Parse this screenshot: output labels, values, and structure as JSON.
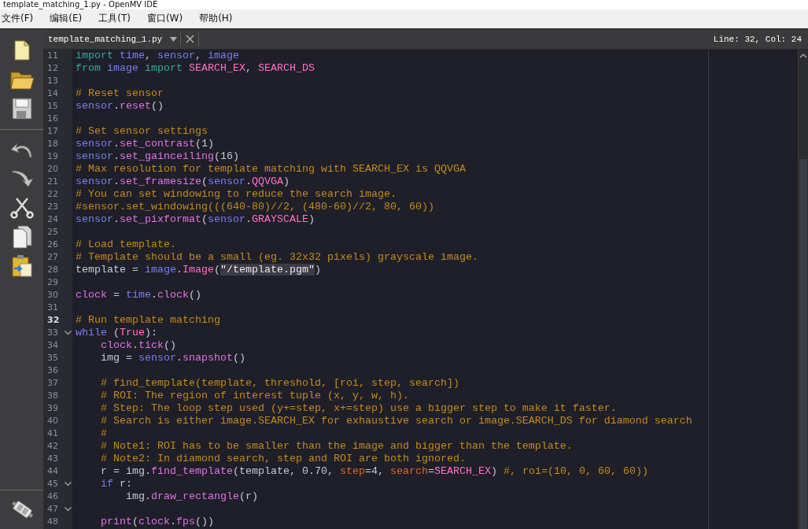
{
  "window": {
    "title": "template_matching_1.py - OpenMV IDE"
  },
  "menu": [
    {
      "label": "文件(F)"
    },
    {
      "label": "编辑(E)"
    },
    {
      "label": "工具(T)"
    },
    {
      "label": "窗口(W)"
    },
    {
      "label": "帮助(H)"
    }
  ],
  "tab": {
    "label": "template_matching_1.py",
    "selected": true
  },
  "cursor_position": "Line: 32, Col: 24",
  "editor": {
    "lines": [
      {
        "number": "11",
        "fold": false,
        "current": false,
        "tokens": [
          {
            "kind": "keyword",
            "text": "import"
          },
          {
            "kind": "name",
            "text": " time"
          },
          {
            "kind": "plain",
            "text": ", "
          },
          {
            "kind": "name",
            "text": "sensor"
          },
          {
            "kind": "plain",
            "text": ", "
          },
          {
            "kind": "name",
            "text": "image"
          }
        ]
      },
      {
        "number": "12",
        "fold": false,
        "current": false,
        "tokens": [
          {
            "kind": "keyword",
            "text": "from"
          },
          {
            "kind": "name",
            "text": " image"
          },
          {
            "kind": "keyword",
            "text": " import"
          },
          {
            "kind": "constant",
            "text": " SEARCH_EX"
          },
          {
            "kind": "plain",
            "text": ", "
          },
          {
            "kind": "constant",
            "text": "SEARCH_DS"
          }
        ]
      },
      {
        "number": "13",
        "fold": false,
        "current": false
      },
      {
        "number": "14",
        "fold": false,
        "current": false,
        "tokens": [
          {
            "kind": "comment",
            "text": "# Reset sensor"
          }
        ]
      },
      {
        "number": "15",
        "fold": false,
        "current": false,
        "tokens": [
          {
            "kind": "name",
            "text": "sensor"
          },
          {
            "kind": "plain",
            "text": "."
          },
          {
            "kind": "call",
            "text": "reset"
          },
          {
            "kind": "plain",
            "text": "()"
          }
        ]
      },
      {
        "number": "16",
        "fold": false,
        "current": false
      },
      {
        "number": "17",
        "fold": false,
        "current": false,
        "tokens": [
          {
            "kind": "comment",
            "text": "# Set sensor settings"
          }
        ]
      },
      {
        "number": "18",
        "fold": false,
        "current": false,
        "tokens": [
          {
            "kind": "name",
            "text": "sensor"
          },
          {
            "kind": "plain",
            "text": "."
          },
          {
            "kind": "call",
            "text": "set_contrast"
          },
          {
            "kind": "plain",
            "text": "(1)"
          }
        ]
      },
      {
        "number": "19",
        "fold": false,
        "current": false,
        "tokens": [
          {
            "kind": "name",
            "text": "sensor"
          },
          {
            "kind": "plain",
            "text": "."
          },
          {
            "kind": "call",
            "text": "set_gainceiling"
          },
          {
            "kind": "plain",
            "text": "(16)"
          }
        ]
      },
      {
        "number": "20",
        "fold": false,
        "current": false,
        "tokens": [
          {
            "kind": "comment",
            "text": "# Max resolution for template matching with SEARCH_EX is QQVGA"
          }
        ]
      },
      {
        "number": "21",
        "fold": false,
        "current": false,
        "tokens": [
          {
            "kind": "name",
            "text": "sensor"
          },
          {
            "kind": "plain",
            "text": "."
          },
          {
            "kind": "call",
            "text": "set_framesize"
          },
          {
            "kind": "plain",
            "text": "("
          },
          {
            "kind": "name",
            "text": "sensor"
          },
          {
            "kind": "plain",
            "text": "."
          },
          {
            "kind": "constant",
            "text": "QQVGA"
          },
          {
            "kind": "plain",
            "text": ")"
          }
        ]
      },
      {
        "number": "22",
        "fold": false,
        "current": false,
        "tokens": [
          {
            "kind": "comment",
            "text": "# You can set windowing to reduce the search image."
          }
        ]
      },
      {
        "number": "23",
        "fold": false,
        "current": false,
        "tokens": [
          {
            "kind": "comment",
            "text": "#sensor.set_windowing(((640-80)//2, (480-60)//2, 80, 60))"
          }
        ]
      },
      {
        "number": "24",
        "fold": false,
        "current": false,
        "tokens": [
          {
            "kind": "name",
            "text": "sensor"
          },
          {
            "kind": "plain",
            "text": "."
          },
          {
            "kind": "call",
            "text": "set_pixformat"
          },
          {
            "kind": "plain",
            "text": "("
          },
          {
            "kind": "name",
            "text": "sensor"
          },
          {
            "kind": "plain",
            "text": "."
          },
          {
            "kind": "constant",
            "text": "GRAYSCALE"
          },
          {
            "kind": "plain",
            "text": ")"
          }
        ]
      },
      {
        "number": "25",
        "fold": false,
        "current": false
      },
      {
        "number": "26",
        "fold": false,
        "current": false,
        "tokens": [
          {
            "kind": "comment",
            "text": "# Load template."
          }
        ]
      },
      {
        "number": "27",
        "fold": false,
        "current": false,
        "tokens": [
          {
            "kind": "comment",
            "text": "# Template should be a small (eg. 32x32 pixels) grayscale image."
          }
        ]
      },
      {
        "number": "28",
        "fold": false,
        "current": false,
        "tokens": [
          {
            "kind": "plain",
            "text": "template = "
          },
          {
            "kind": "name",
            "text": "image"
          },
          {
            "kind": "plain",
            "text": "."
          },
          {
            "kind": "constant",
            "text": "Image"
          },
          {
            "kind": "plain",
            "text": "("
          },
          {
            "kind": "string",
            "text": "\"/template.pgm\""
          },
          {
            "kind": "plain",
            "text": ")"
          }
        ]
      },
      {
        "number": "29",
        "fold": false,
        "current": false
      },
      {
        "number": "30",
        "fold": false,
        "current": false,
        "tokens": [
          {
            "kind": "call",
            "text": "clock"
          },
          {
            "kind": "plain",
            "text": " = "
          },
          {
            "kind": "name",
            "text": "time"
          },
          {
            "kind": "plain",
            "text": "."
          },
          {
            "kind": "call",
            "text": "clock"
          },
          {
            "kind": "plain",
            "text": "()"
          }
        ]
      },
      {
        "number": "31",
        "fold": false,
        "current": false
      },
      {
        "number": "32",
        "fold": false,
        "current": true,
        "tokens": [
          {
            "kind": "comment",
            "text": "# Run template matching"
          }
        ]
      },
      {
        "number": "33",
        "fold": true,
        "current": false,
        "tokens": [
          {
            "kind": "name",
            "text": "while"
          },
          {
            "kind": "plain",
            "text": " ("
          },
          {
            "kind": "constant",
            "text": "True"
          },
          {
            "kind": "plain",
            "text": "):"
          }
        ]
      },
      {
        "number": "34",
        "fold": false,
        "current": false,
        "tokens": [
          {
            "kind": "call",
            "text": "    clock"
          },
          {
            "kind": "plain",
            "text": "."
          },
          {
            "kind": "call",
            "text": "tick"
          },
          {
            "kind": "plain",
            "text": "()"
          }
        ]
      },
      {
        "number": "35",
        "fold": false,
        "current": false,
        "tokens": [
          {
            "kind": "plain",
            "text": "    img = "
          },
          {
            "kind": "name",
            "text": "sensor"
          },
          {
            "kind": "plain",
            "text": "."
          },
          {
            "kind": "call",
            "text": "snapshot"
          },
          {
            "kind": "plain",
            "text": "()"
          }
        ]
      },
      {
        "number": "36",
        "fold": false,
        "current": false
      },
      {
        "number": "37",
        "fold": false,
        "current": false,
        "tokens": [
          {
            "kind": "comment",
            "text": "    # find_template(template, threshold, [roi, step, search])"
          }
        ]
      },
      {
        "number": "38",
        "fold": false,
        "current": false,
        "tokens": [
          {
            "kind": "comment",
            "text": "    # ROI: The region of interest tuple (x, y, w, h)."
          }
        ]
      },
      {
        "number": "39",
        "fold": false,
        "current": false,
        "tokens": [
          {
            "kind": "comment",
            "text": "    # Step: The loop step used (y+=step, x+=step) use a bigger step to make it faster."
          }
        ]
      },
      {
        "number": "40",
        "fold": false,
        "current": false,
        "tokens": [
          {
            "kind": "comment",
            "text": "    # Search is either image.SEARCH_EX for exhaustive search or image.SEARCH_DS for diamond search"
          }
        ]
      },
      {
        "number": "41",
        "fold": false,
        "current": false,
        "tokens": [
          {
            "kind": "comment",
            "text": "    #"
          }
        ]
      },
      {
        "number": "42",
        "fold": false,
        "current": false,
        "tokens": [
          {
            "kind": "comment",
            "text": "    # Note1: ROI has to be smaller than the image and bigger than the template."
          }
        ]
      },
      {
        "number": "43",
        "fold": false,
        "current": false,
        "tokens": [
          {
            "kind": "comment",
            "text": "    # Note2: In diamond search, step and ROI are both ignored."
          }
        ]
      },
      {
        "number": "44",
        "fold": false,
        "current": false,
        "tokens": [
          {
            "kind": "plain",
            "text": "    r = img."
          },
          {
            "kind": "call",
            "text": "find_template"
          },
          {
            "kind": "plain",
            "text": "(template, 0.70, "
          },
          {
            "kind": "param",
            "text": "step"
          },
          {
            "kind": "plain",
            "text": "=4, "
          },
          {
            "kind": "param",
            "text": "search"
          },
          {
            "kind": "plain",
            "text": "="
          },
          {
            "kind": "constant",
            "text": "SEARCH_EX"
          },
          {
            "kind": "plain",
            "text": ") "
          },
          {
            "kind": "comment",
            "text": "#, roi=(10, 0, 60, 60))"
          }
        ]
      },
      {
        "number": "45",
        "fold": true,
        "current": false,
        "tokens": [
          {
            "kind": "name",
            "text": "    if"
          },
          {
            "kind": "plain",
            "text": " r:"
          }
        ]
      },
      {
        "number": "46",
        "fold": false,
        "current": false,
        "tokens": [
          {
            "kind": "plain",
            "text": "        img."
          },
          {
            "kind": "call",
            "text": "draw_rectangle"
          },
          {
            "kind": "plain",
            "text": "(r)"
          }
        ]
      },
      {
        "number": "47",
        "fold": true,
        "current": false
      },
      {
        "number": "48",
        "fold": false,
        "current": false,
        "tokens": [
          {
            "kind": "call",
            "text": "    print"
          },
          {
            "kind": "plain",
            "text": "("
          },
          {
            "kind": "call",
            "text": "clock"
          },
          {
            "kind": "plain",
            "text": "."
          },
          {
            "kind": "call",
            "text": "fps"
          },
          {
            "kind": "plain",
            "text": "())"
          }
        ]
      }
    ]
  }
}
